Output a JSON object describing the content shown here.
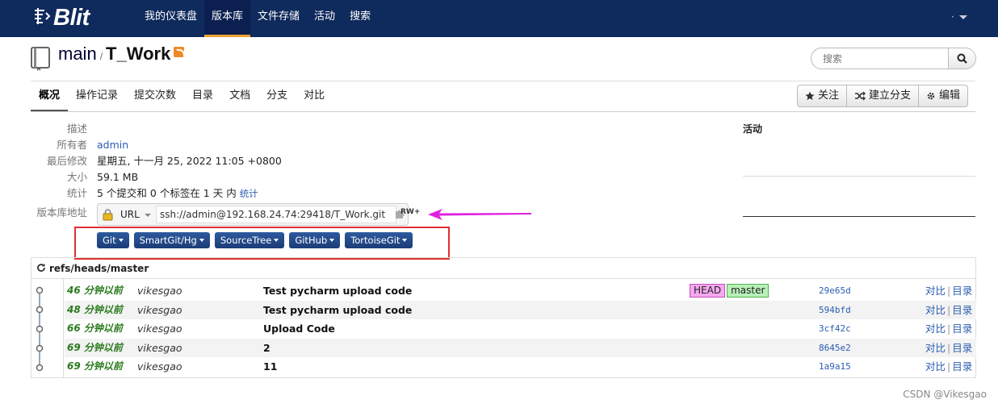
{
  "app": {
    "logo_text": "Blit"
  },
  "nav": {
    "items": [
      {
        "label": "我的仪表盘"
      },
      {
        "label": "版本库"
      },
      {
        "label": "文件存储"
      },
      {
        "label": "活动"
      },
      {
        "label": "搜索"
      }
    ],
    "active_index": 1,
    "user_menu_label": "·"
  },
  "repo": {
    "project": "main",
    "separator": "/",
    "name": "T_Work"
  },
  "search": {
    "placeholder": "搜索"
  },
  "tabs": [
    {
      "label": "概况"
    },
    {
      "label": "操作记录"
    },
    {
      "label": "提交次数"
    },
    {
      "label": "目录"
    },
    {
      "label": "文档"
    },
    {
      "label": "分支"
    },
    {
      "label": "对比"
    }
  ],
  "actions": {
    "watch": "关注",
    "fork": "建立分支",
    "edit": "编辑"
  },
  "summary": {
    "description_label": "描述",
    "description_value": "",
    "owner_label": "所有者",
    "owner_value": "admin",
    "modified_label": "最后修改",
    "modified_value": "星期五, 十一月 25, 2022 11:05 +0800",
    "size_label": "大小",
    "size_value": "59.1 MB",
    "stats_label": "统计",
    "stats_value": "5 个提交和 0 个标签在 1 天 内",
    "stats_link": "统计",
    "url_label": "版本库地址",
    "url_protocol": "URL",
    "url_value": "ssh://admin@192.168.24.74:29418/T_Work.git",
    "permission": "RW+"
  },
  "clients": [
    {
      "label": "Git"
    },
    {
      "label": "SmartGit/Hg"
    },
    {
      "label": "SourceTree"
    },
    {
      "label": "GitHub"
    },
    {
      "label": "TortoiseGit"
    }
  ],
  "activity": {
    "title": "活动"
  },
  "commits": {
    "ref": "refs/heads/master",
    "rows": [
      {
        "age": "46 分钟以前",
        "author": "vikesgao",
        "message": "Test pycharm upload code",
        "head": "HEAD",
        "branch": "master",
        "hash": "29e65d",
        "compare": "对比",
        "tree": "目录"
      },
      {
        "age": "48 分钟以前",
        "author": "vikesgao",
        "message": "Test pycharm upload code",
        "head": "",
        "branch": "",
        "hash": "594bfd",
        "compare": "对比",
        "tree": "目录"
      },
      {
        "age": "66 分钟以前",
        "author": "vikesgao",
        "message": "Upload Code",
        "head": "",
        "branch": "",
        "hash": "3cf42c",
        "compare": "对比",
        "tree": "目录"
      },
      {
        "age": "69 分钟以前",
        "author": "vikesgao",
        "message": "2",
        "head": "",
        "branch": "",
        "hash": "8645e2",
        "compare": "对比",
        "tree": "目录"
      },
      {
        "age": "69 分钟以前",
        "author": "vikesgao",
        "message": "11",
        "head": "",
        "branch": "",
        "hash": "1a9a15",
        "compare": "对比",
        "tree": "目录"
      }
    ]
  },
  "watermark": "CSDN @Vikesgao",
  "colors": {
    "topbar": "#0f2a5c",
    "active_tab_underline": "#f0a030",
    "commit_age": "#2b7a1e",
    "link": "#2a5db0",
    "annotation_red": "#e03030",
    "annotation_arrow": "#e020e0"
  }
}
